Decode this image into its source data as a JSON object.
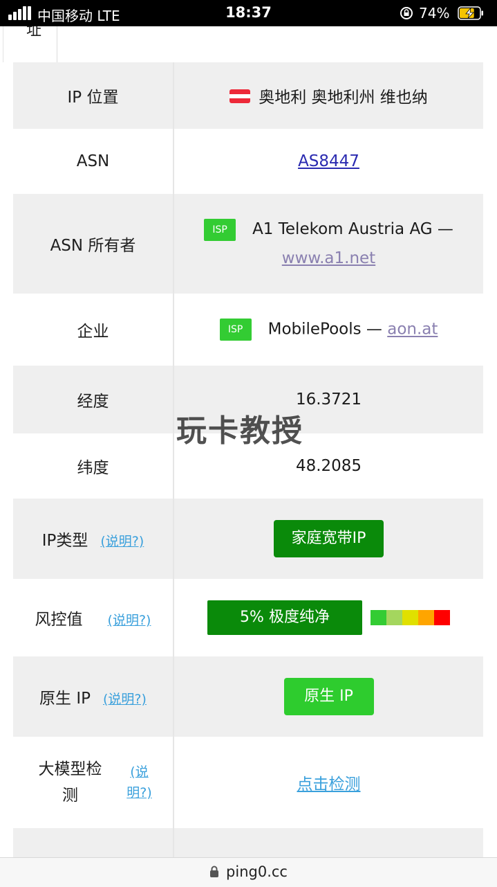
{
  "status_bar": {
    "carrier": "中国移动  LTE",
    "time": "18:37",
    "battery_percent": "74%",
    "battery_level": 0.74
  },
  "top_fragment_char": "址",
  "rows": {
    "ip_location": {
      "label": "IP 位置",
      "value": "奥地利 奥地利州 维也纳",
      "flag_colors": [
        "#ed2939",
        "#ffffff",
        "#ed2939"
      ]
    },
    "asn": {
      "label": "ASN",
      "value": "AS8447"
    },
    "asn_owner": {
      "label": "ASN 所有者",
      "tag": "ISP",
      "name": "A1 Telekom Austria AG —",
      "link": "www.a1.net"
    },
    "enterprise": {
      "label": "企业",
      "tag": "ISP",
      "name": "MobilePools —",
      "link": "aon.at"
    },
    "longitude": {
      "label": "经度",
      "value": "16.3721"
    },
    "latitude": {
      "label": "纬度",
      "value": "48.2085"
    },
    "ip_type": {
      "label": "IP类型",
      "explain": "(说明?)",
      "value": "家庭宽带IP"
    },
    "risk": {
      "label": "风控值",
      "explain": "(说明?)",
      "value": "5%   极度纯净",
      "risk_percent": 5,
      "scale_colors": [
        "#33cc33",
        "#a4d65e",
        "#e0e000",
        "#ffa500",
        "#ff0000"
      ]
    },
    "native_ip": {
      "label": "原生 IP",
      "explain": "(说明?)",
      "value": "原生 IP"
    },
    "llm_detect": {
      "label": "大模型检测",
      "explain": "(说明?)",
      "value": "点击检测"
    }
  },
  "watermark": "玩卡教授",
  "url_bar": {
    "url": "ping0.cc"
  },
  "colors": {
    "dark_green": "#0a8a0a",
    "light_green": "#2ecc2e",
    "link_blue": "#3aa0dc"
  }
}
